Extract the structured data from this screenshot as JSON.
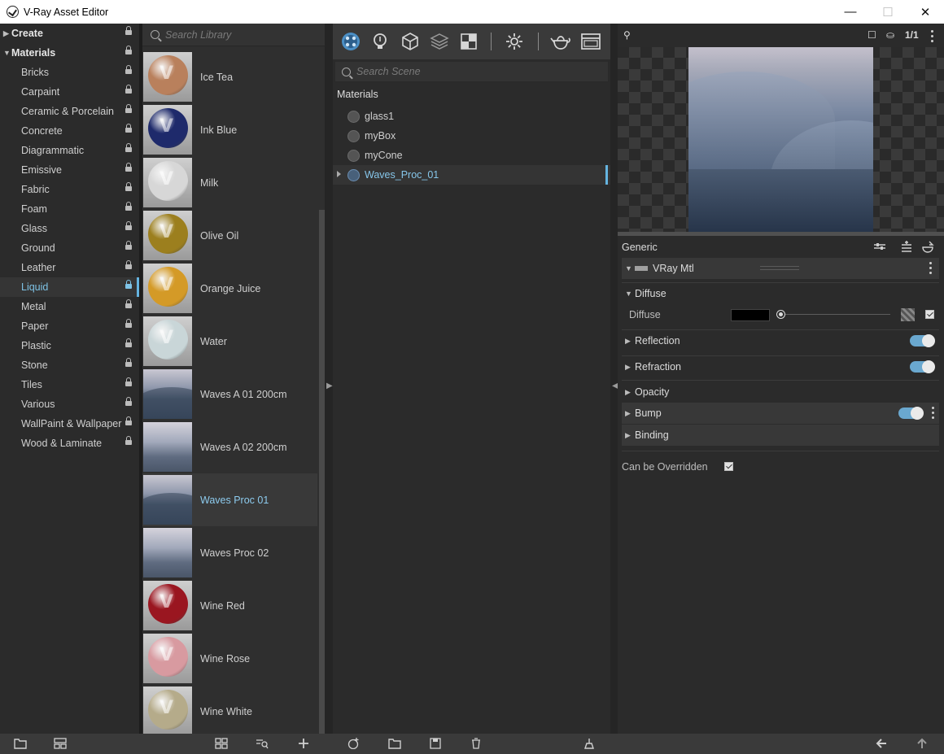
{
  "window": {
    "title": "V-Ray Asset Editor",
    "minimize": "—",
    "maximize": "☐",
    "close": "✕"
  },
  "categories": [
    {
      "label": "Create",
      "top": true,
      "caret": "▶"
    },
    {
      "label": "Materials",
      "top": true,
      "caret": "▼"
    },
    {
      "label": "Bricks"
    },
    {
      "label": "Carpaint"
    },
    {
      "label": "Ceramic & Porcelain"
    },
    {
      "label": "Concrete"
    },
    {
      "label": "Diagrammatic"
    },
    {
      "label": "Emissive"
    },
    {
      "label": "Fabric"
    },
    {
      "label": "Foam"
    },
    {
      "label": "Glass"
    },
    {
      "label": "Ground"
    },
    {
      "label": "Leather"
    },
    {
      "label": "Liquid",
      "active": true
    },
    {
      "label": "Metal"
    },
    {
      "label": "Paper"
    },
    {
      "label": "Plastic"
    },
    {
      "label": "Stone"
    },
    {
      "label": "Tiles"
    },
    {
      "label": "Various"
    },
    {
      "label": "WallPaint & Wallpaper"
    },
    {
      "label": "Wood & Laminate"
    }
  ],
  "library": {
    "search_placeholder": "Search Library",
    "items": [
      {
        "label": "Ice Tea",
        "kind": "sphere",
        "color": "#b9805c"
      },
      {
        "label": "Ink Blue",
        "kind": "sphere",
        "color": "#1e2a6b"
      },
      {
        "label": "Milk",
        "kind": "sphere",
        "color": "#d7d7d7"
      },
      {
        "label": "Olive Oil",
        "kind": "sphere",
        "color": "#9c7f1e"
      },
      {
        "label": "Orange Juice",
        "kind": "sphere",
        "color": "#d49a27"
      },
      {
        "label": "Water",
        "kind": "sphere",
        "color": "#c9d6d8"
      },
      {
        "label": "Waves A 01 200cm",
        "kind": "waves"
      },
      {
        "label": "Waves A 02 200cm",
        "kind": "waves2"
      },
      {
        "label": "Waves Proc 01",
        "kind": "waves",
        "active": true
      },
      {
        "label": "Waves Proc 02",
        "kind": "waves2"
      },
      {
        "label": "Wine Red",
        "kind": "sphere",
        "color": "#9a1620"
      },
      {
        "label": "Wine Rose",
        "kind": "sphere",
        "color": "#d89aa0"
      },
      {
        "label": "Wine White",
        "kind": "sphere",
        "color": "#b5ab8a"
      }
    ]
  },
  "scene": {
    "search_placeholder": "Search Scene",
    "heading": "Materials",
    "items": [
      {
        "label": "glass1"
      },
      {
        "label": "myBox"
      },
      {
        "label": "myCone"
      },
      {
        "label": "Waves_Proc_01",
        "active": true
      }
    ]
  },
  "properties": {
    "header": "Generic",
    "material_type": "VRay Mtl",
    "diffuse_section": "Diffuse",
    "diffuse_label": "Diffuse",
    "diffuse_color": "#000000",
    "sections": {
      "reflection": "Reflection",
      "refraction": "Refraction",
      "opacity": "Opacity",
      "bump": "Bump",
      "binding": "Binding"
    },
    "override_label": "Can be Overridden",
    "preview_ratio": "1/1"
  },
  "colors": {
    "accent": "#65b4e0",
    "toggle_on": "#6aa8cf"
  }
}
